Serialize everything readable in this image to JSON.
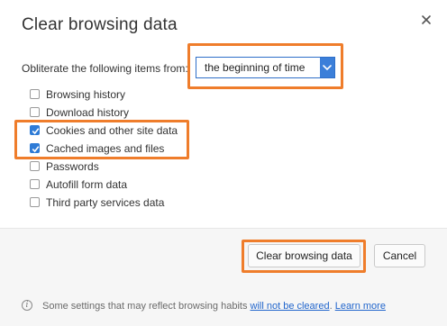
{
  "dialog": {
    "title": "Clear browsing data",
    "close_icon": "close-icon"
  },
  "period": {
    "label": "Obliterate the following items from:",
    "selected": "the beginning of time"
  },
  "items": [
    {
      "label": "Browsing history",
      "checked": false
    },
    {
      "label": "Download history",
      "checked": false
    },
    {
      "label": "Cookies and other site data",
      "checked": true
    },
    {
      "label": "Cached images and files",
      "checked": true
    },
    {
      "label": "Passwords",
      "checked": false
    },
    {
      "label": "Autofill form data",
      "checked": false
    },
    {
      "label": "Third party services data",
      "checked": false
    }
  ],
  "buttons": {
    "clear": "Clear browsing data",
    "cancel": "Cancel"
  },
  "footer": {
    "note": "Some settings that may reflect browsing habits",
    "link1": "will not be cleared",
    "period_sep": ".",
    "link2": "Learn more"
  },
  "colors": {
    "highlight": "#ef7d2b",
    "accent": "#2e7bd6",
    "link": "#2266cc"
  }
}
